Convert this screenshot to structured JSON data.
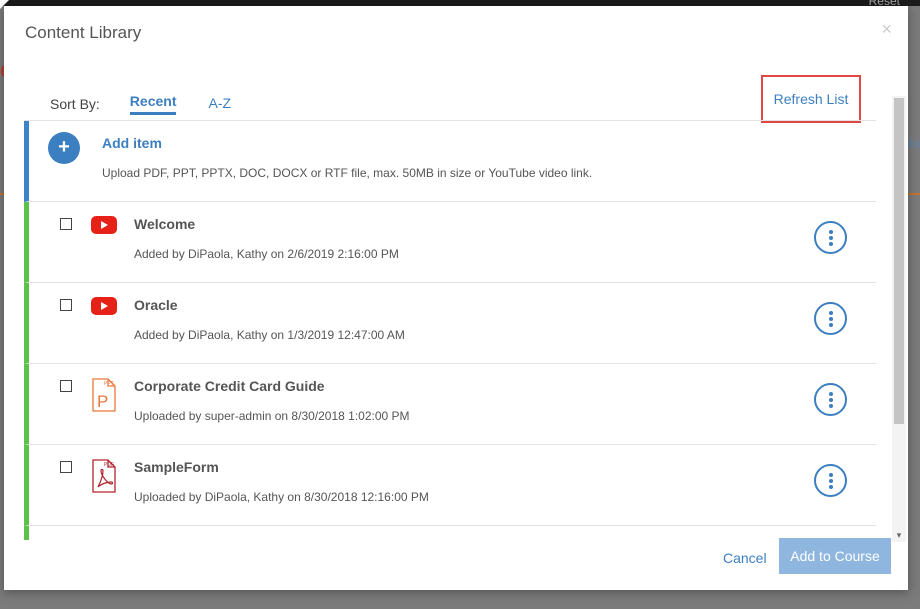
{
  "background": {
    "top_right_text": "Reset",
    "right_edge_text": "clo",
    "red_letter": "e"
  },
  "modal": {
    "title": "Content Library",
    "close_glyph": "×"
  },
  "sort": {
    "label": "Sort By:",
    "tabs": [
      {
        "label": "Recent",
        "active": true
      },
      {
        "label": "A-Z",
        "active": false
      }
    ]
  },
  "refresh_label": "Refresh List",
  "add_item": {
    "title": "Add item",
    "description": "Upload PDF, PPT, PPTX, DOC, DOCX or RTF file, max. 50MB in size or YouTube video link.",
    "icon": "plus-icon"
  },
  "items": [
    {
      "title": "Welcome",
      "subtitle": "Added by DiPaola, Kathy on 2/6/2019 2:16:00 PM",
      "icon": "youtube-icon"
    },
    {
      "title": "Oracle",
      "subtitle": "Added by DiPaola, Kathy on 1/3/2019 12:47:00 AM",
      "icon": "youtube-icon"
    },
    {
      "title": "Corporate Credit Card Guide",
      "subtitle": "Uploaded by super-admin on 8/30/2018 1:02:00 PM",
      "icon": "ppt-file-icon"
    },
    {
      "title": "SampleForm",
      "subtitle": "Uploaded by DiPaola, Kathy on 8/30/2018 12:16:00 PM",
      "icon": "pdf-file-icon"
    }
  ],
  "icon_labels": {
    "ppt": "PPT",
    "pdf": "PDF"
  },
  "footer": {
    "cancel_label": "Cancel",
    "add_label": "Add to Course"
  },
  "colors": {
    "accent": "#3c7fc1",
    "add_bar": "#3c83c8",
    "item_bar": "#5cc24a",
    "highlight_box": "#e04848",
    "youtube": "#e62117",
    "ppt": "#e9773f",
    "pdf": "#b0252c"
  }
}
